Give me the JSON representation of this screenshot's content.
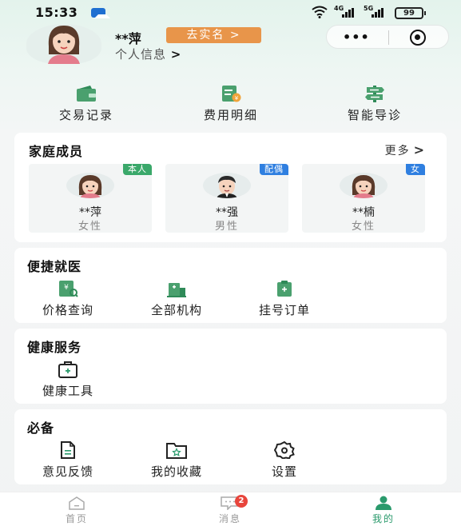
{
  "status_bar": {
    "time": "15:33",
    "network_4g": "4G",
    "network_5g": "5G",
    "battery": "99"
  },
  "profile": {
    "name": "**萍",
    "verify_label": "去实名 >",
    "info_label": "个人信息",
    "info_chevron": ">",
    "capsule_dots": "•••"
  },
  "quick_actions": [
    {
      "label": "交易记录",
      "icon": "wallet-icon"
    },
    {
      "label": "费用明细",
      "icon": "bill-icon"
    },
    {
      "label": "智能导诊",
      "icon": "signpost-icon"
    }
  ],
  "family": {
    "title": "家庭成员",
    "more_label": "更多",
    "more_chevron": ">",
    "members": [
      {
        "tag": "本人",
        "name": "**萍",
        "gender": "女性",
        "tag_color": "#3aa86a"
      },
      {
        "tag": "配偶",
        "name": "**强",
        "gender": "男性",
        "tag_color": "#2f7fe0"
      },
      {
        "tag": "女",
        "name": "**楠",
        "gender": "女性",
        "tag_color": "#2f7fe0"
      }
    ]
  },
  "convenient": {
    "title": "便捷就医",
    "items": [
      {
        "label": "价格查询",
        "icon": "price-query-icon"
      },
      {
        "label": "全部机构",
        "icon": "institution-icon"
      },
      {
        "label": "挂号订单",
        "icon": "registration-order-icon"
      }
    ]
  },
  "health": {
    "title": "健康服务",
    "items": [
      {
        "label": "健康工具",
        "icon": "medical-kit-icon"
      }
    ]
  },
  "essential": {
    "title": "必备",
    "items": [
      {
        "label": "意见反馈",
        "icon": "feedback-icon"
      },
      {
        "label": "我的收藏",
        "icon": "favorites-icon"
      },
      {
        "label": "设置",
        "icon": "settings-icon"
      }
    ]
  },
  "tabbar": {
    "tabs": [
      {
        "label": "首页",
        "icon": "home-icon"
      },
      {
        "label": "消息",
        "icon": "message-icon",
        "badge": "2"
      },
      {
        "label": "我的",
        "icon": "profile-icon"
      }
    ]
  },
  "colors": {
    "accent_green": "#2a9a6c",
    "verify_orange": "#e8954a",
    "tag_green": "#3aa86a",
    "tag_blue": "#2f7fe0",
    "badge_red": "#e8453c"
  }
}
